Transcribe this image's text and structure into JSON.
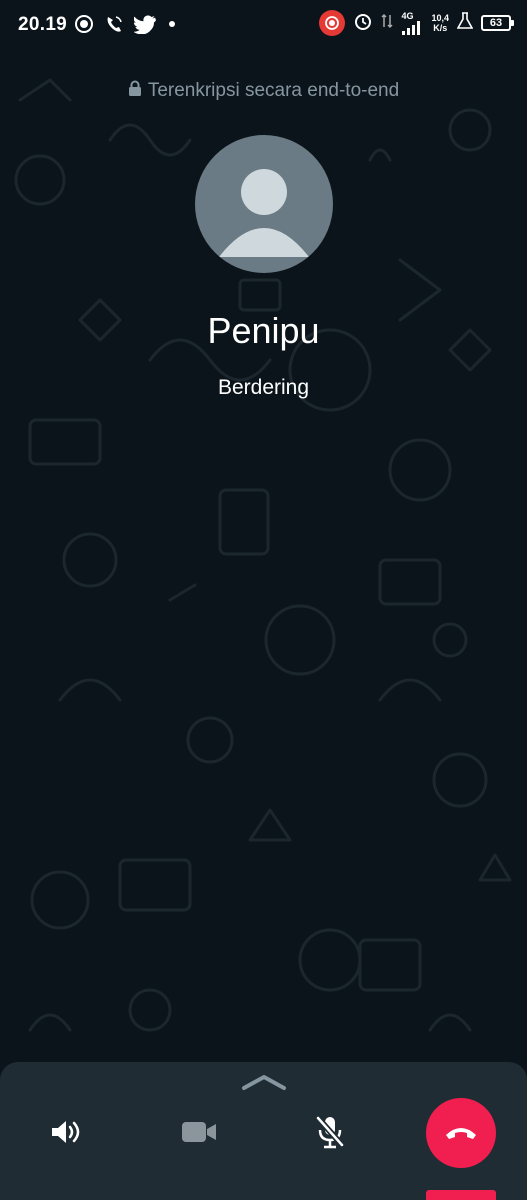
{
  "status_bar": {
    "time": "20.19",
    "network": "4G",
    "speed_value": "10,4",
    "speed_unit": "K/s",
    "battery": "63",
    "left_icons": [
      "screen-record-icon",
      "wifi-call-icon",
      "twitter-icon",
      "dot-icon"
    ],
    "right_icons": [
      "record-indicator-icon",
      "alarm-icon",
      "data-arrows-icon",
      "signal-icon",
      "lab-icon",
      "battery-icon"
    ]
  },
  "call": {
    "encryption_text": "Terenkripsi secara end-to-end",
    "caller_name": "Penipu",
    "status": "Berdering"
  },
  "controls": {
    "icons": [
      "speaker-icon",
      "video-icon",
      "mic-off-icon",
      "end-call-icon"
    ]
  },
  "colors": {
    "background": "#0b141a",
    "panel": "#1f2c34",
    "end_call": "#f01f4f",
    "muted_text": "#8696a0",
    "avatar": "#6a7b85"
  }
}
